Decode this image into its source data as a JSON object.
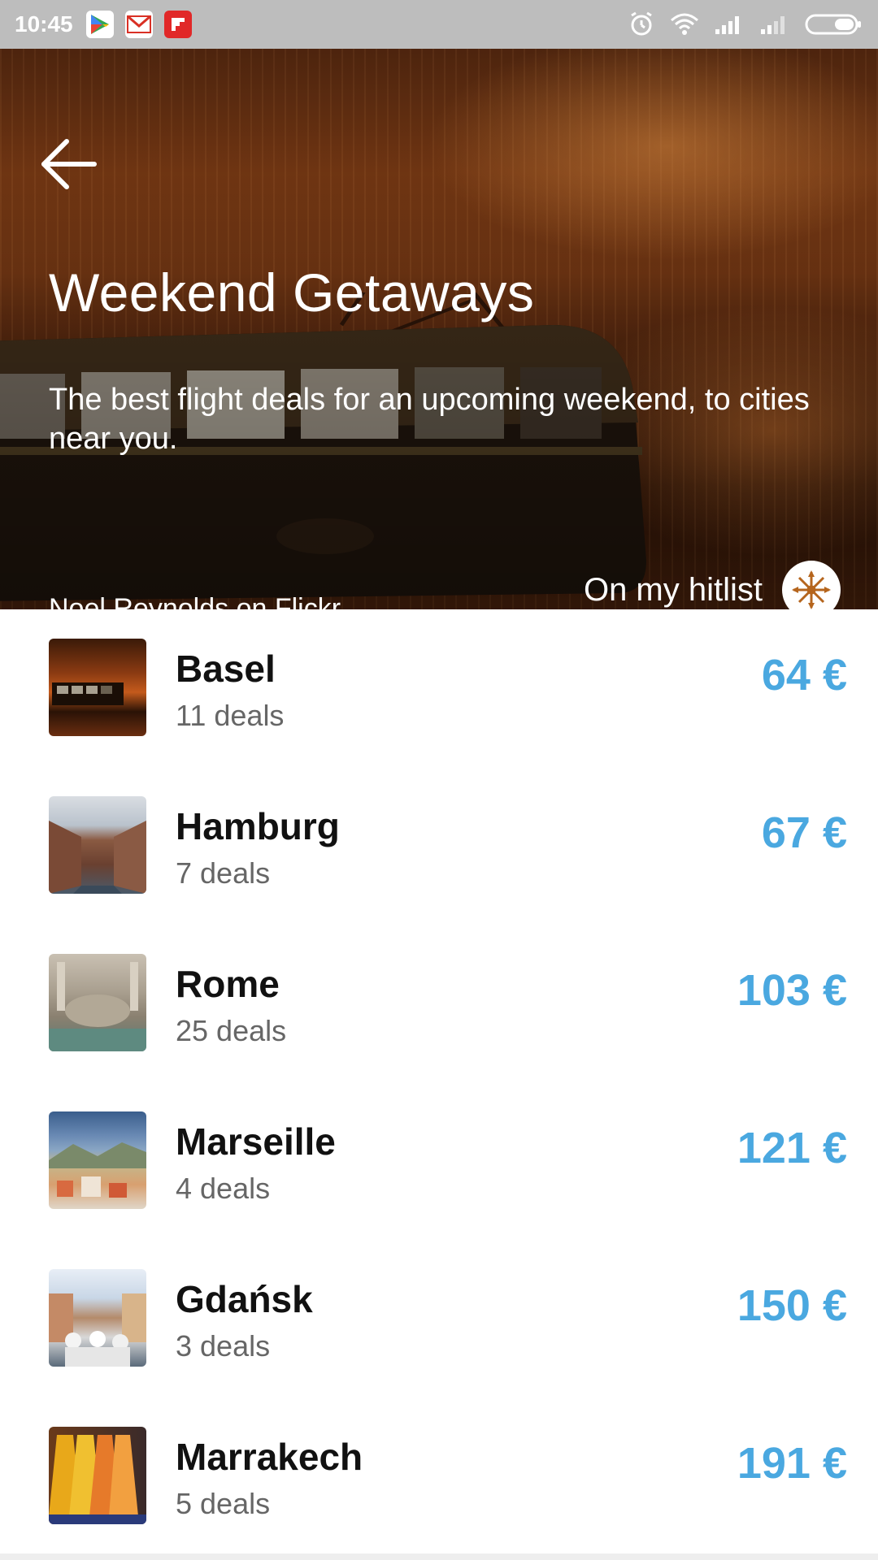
{
  "status_bar": {
    "time": "10:45",
    "apps": [
      "play-store-icon",
      "gmail-icon",
      "flipboard-icon"
    ],
    "indicators": [
      "alarm-icon",
      "wifi-icon",
      "signal-icon",
      "signal-icon-2",
      "battery-icon"
    ]
  },
  "hero": {
    "title": "Weekend Getaways",
    "subtitle": "The best flight deals for an upcoming weekend, to cities near you.",
    "photo_credit": "Noel Reynolds on Flickr",
    "hitlist_label": "On my hitlist"
  },
  "deals": [
    {
      "city": "Basel",
      "count": "11 deals",
      "price": "64 €"
    },
    {
      "city": "Hamburg",
      "count": "7 deals",
      "price": "67 €"
    },
    {
      "city": "Rome",
      "count": "25 deals",
      "price": "103 €"
    },
    {
      "city": "Marseille",
      "count": "4 deals",
      "price": "121 €"
    },
    {
      "city": "Gdańsk",
      "count": "3 deals",
      "price": "150 €"
    },
    {
      "city": "Marrakech",
      "count": "5 deals",
      "price": "191 €"
    }
  ],
  "colors": {
    "price": "#4aa8e0",
    "status_bar": "#bdbdbd",
    "hitlist_icon": "#b5651d"
  }
}
